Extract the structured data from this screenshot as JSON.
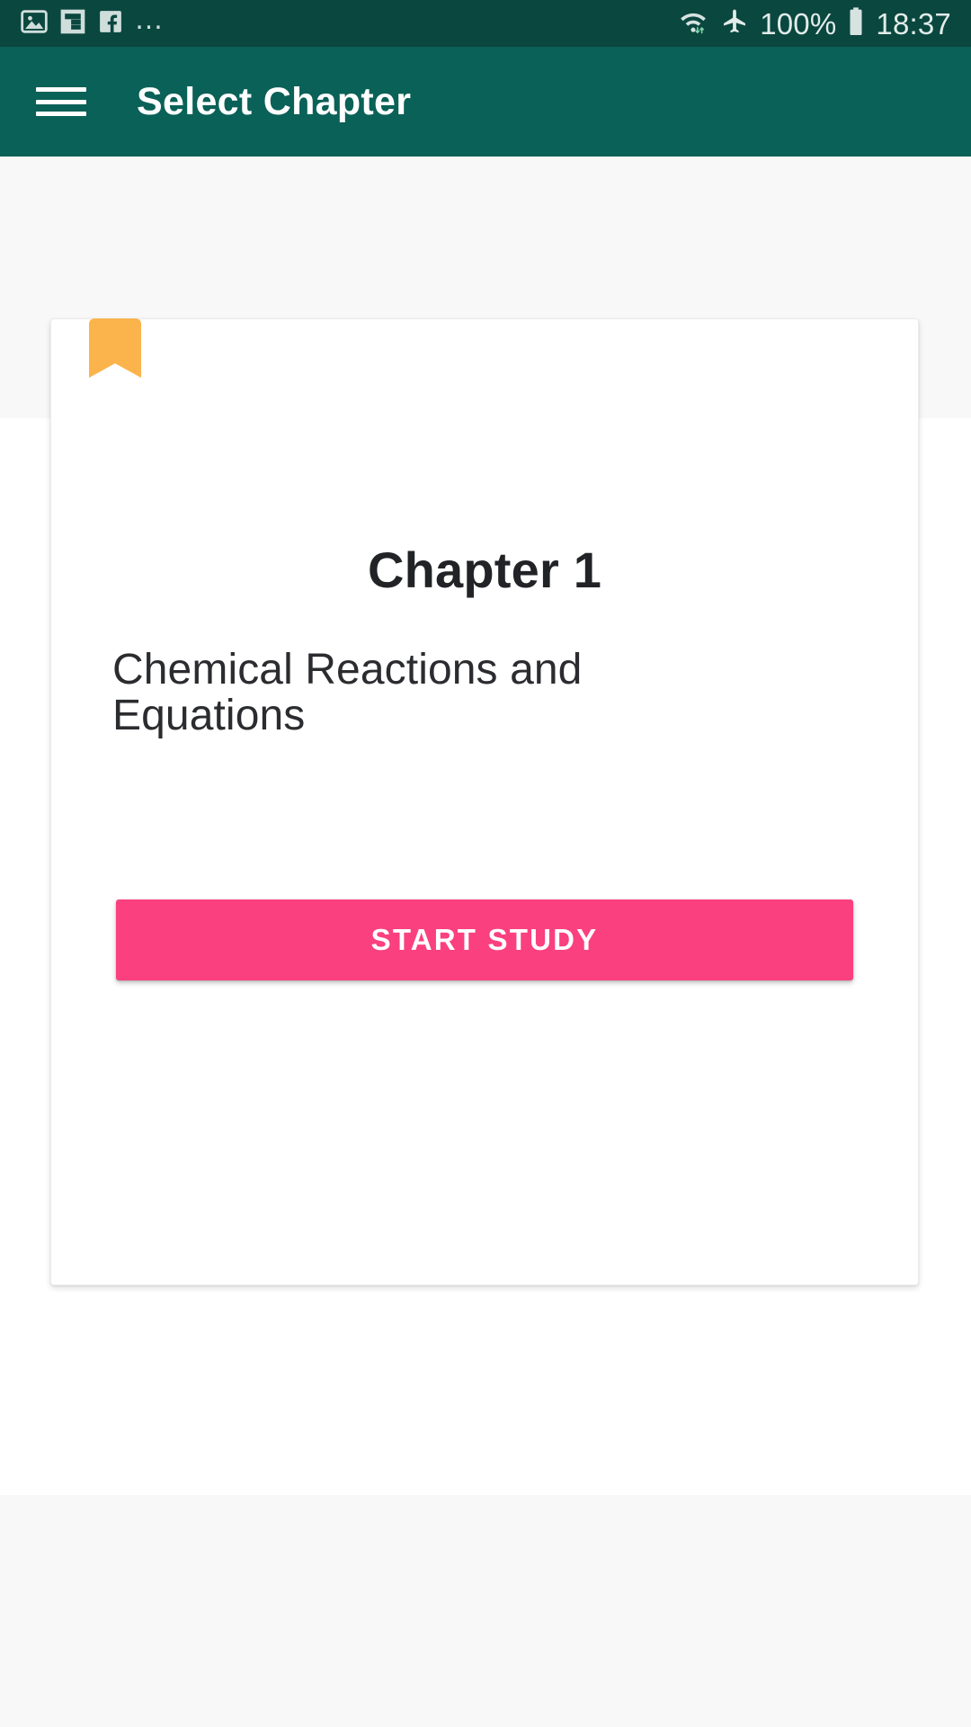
{
  "status_bar": {
    "background_color": "#0a473f",
    "notification_icons": [
      {
        "name": "photo-icon",
        "label": "Photos"
      },
      {
        "name": "flipboard-icon",
        "label": "Flipboard"
      },
      {
        "name": "facebook-icon",
        "label": "Facebook"
      }
    ],
    "overflow_indicator": "…",
    "wifi_icon": "wifi-icon",
    "airplane_icon": "airplane-mode-icon",
    "battery_percent": "100%",
    "battery_icon": "battery-full-icon",
    "time": "18:37"
  },
  "app_bar": {
    "background_color": "#0a6157",
    "menu_icon": "hamburger-menu-icon",
    "title": "Select Chapter"
  },
  "card": {
    "bookmark_icon": "bookmark-icon",
    "bookmark_color": "#fbb44c",
    "title": "Chapter 1",
    "subtitle": "Chemical Reactions and Equations",
    "button_label": "START STUDY",
    "button_color": "#fb4080"
  }
}
